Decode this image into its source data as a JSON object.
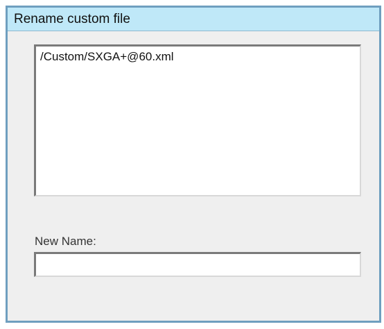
{
  "dialog": {
    "title": "Rename custom file",
    "file_list": {
      "items": [
        {
          "label": "/Custom/SXGA+@60.xml"
        }
      ]
    },
    "new_name": {
      "label": "New Name:",
      "value": "",
      "placeholder": ""
    }
  }
}
